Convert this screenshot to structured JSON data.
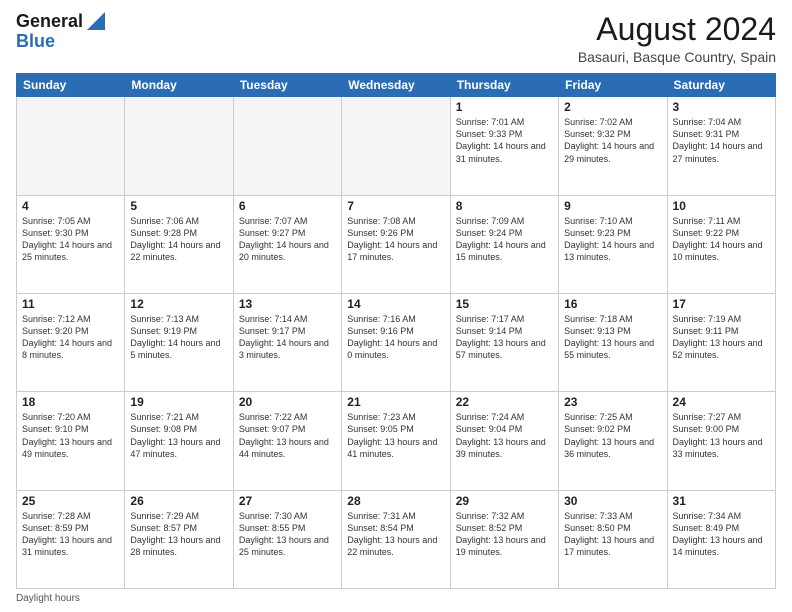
{
  "header": {
    "logo_general": "General",
    "logo_blue": "Blue",
    "main_title": "August 2024",
    "subtitle": "Basauri, Basque Country, Spain"
  },
  "days_of_week": [
    "Sunday",
    "Monday",
    "Tuesday",
    "Wednesday",
    "Thursday",
    "Friday",
    "Saturday"
  ],
  "weeks": [
    [
      {
        "date": "",
        "content": ""
      },
      {
        "date": "",
        "content": ""
      },
      {
        "date": "",
        "content": ""
      },
      {
        "date": "",
        "content": ""
      },
      {
        "date": "1",
        "content": "Sunrise: 7:01 AM\nSunset: 9:33 PM\nDaylight: 14 hours and 31 minutes."
      },
      {
        "date": "2",
        "content": "Sunrise: 7:02 AM\nSunset: 9:32 PM\nDaylight: 14 hours and 29 minutes."
      },
      {
        "date": "3",
        "content": "Sunrise: 7:04 AM\nSunset: 9:31 PM\nDaylight: 14 hours and 27 minutes."
      }
    ],
    [
      {
        "date": "4",
        "content": "Sunrise: 7:05 AM\nSunset: 9:30 PM\nDaylight: 14 hours and 25 minutes."
      },
      {
        "date": "5",
        "content": "Sunrise: 7:06 AM\nSunset: 9:28 PM\nDaylight: 14 hours and 22 minutes."
      },
      {
        "date": "6",
        "content": "Sunrise: 7:07 AM\nSunset: 9:27 PM\nDaylight: 14 hours and 20 minutes."
      },
      {
        "date": "7",
        "content": "Sunrise: 7:08 AM\nSunset: 9:26 PM\nDaylight: 14 hours and 17 minutes."
      },
      {
        "date": "8",
        "content": "Sunrise: 7:09 AM\nSunset: 9:24 PM\nDaylight: 14 hours and 15 minutes."
      },
      {
        "date": "9",
        "content": "Sunrise: 7:10 AM\nSunset: 9:23 PM\nDaylight: 14 hours and 13 minutes."
      },
      {
        "date": "10",
        "content": "Sunrise: 7:11 AM\nSunset: 9:22 PM\nDaylight: 14 hours and 10 minutes."
      }
    ],
    [
      {
        "date": "11",
        "content": "Sunrise: 7:12 AM\nSunset: 9:20 PM\nDaylight: 14 hours and 8 minutes."
      },
      {
        "date": "12",
        "content": "Sunrise: 7:13 AM\nSunset: 9:19 PM\nDaylight: 14 hours and 5 minutes."
      },
      {
        "date": "13",
        "content": "Sunrise: 7:14 AM\nSunset: 9:17 PM\nDaylight: 14 hours and 3 minutes."
      },
      {
        "date": "14",
        "content": "Sunrise: 7:16 AM\nSunset: 9:16 PM\nDaylight: 14 hours and 0 minutes."
      },
      {
        "date": "15",
        "content": "Sunrise: 7:17 AM\nSunset: 9:14 PM\nDaylight: 13 hours and 57 minutes."
      },
      {
        "date": "16",
        "content": "Sunrise: 7:18 AM\nSunset: 9:13 PM\nDaylight: 13 hours and 55 minutes."
      },
      {
        "date": "17",
        "content": "Sunrise: 7:19 AM\nSunset: 9:11 PM\nDaylight: 13 hours and 52 minutes."
      }
    ],
    [
      {
        "date": "18",
        "content": "Sunrise: 7:20 AM\nSunset: 9:10 PM\nDaylight: 13 hours and 49 minutes."
      },
      {
        "date": "19",
        "content": "Sunrise: 7:21 AM\nSunset: 9:08 PM\nDaylight: 13 hours and 47 minutes."
      },
      {
        "date": "20",
        "content": "Sunrise: 7:22 AM\nSunset: 9:07 PM\nDaylight: 13 hours and 44 minutes."
      },
      {
        "date": "21",
        "content": "Sunrise: 7:23 AM\nSunset: 9:05 PM\nDaylight: 13 hours and 41 minutes."
      },
      {
        "date": "22",
        "content": "Sunrise: 7:24 AM\nSunset: 9:04 PM\nDaylight: 13 hours and 39 minutes."
      },
      {
        "date": "23",
        "content": "Sunrise: 7:25 AM\nSunset: 9:02 PM\nDaylight: 13 hours and 36 minutes."
      },
      {
        "date": "24",
        "content": "Sunrise: 7:27 AM\nSunset: 9:00 PM\nDaylight: 13 hours and 33 minutes."
      }
    ],
    [
      {
        "date": "25",
        "content": "Sunrise: 7:28 AM\nSunset: 8:59 PM\nDaylight: 13 hours and 31 minutes."
      },
      {
        "date": "26",
        "content": "Sunrise: 7:29 AM\nSunset: 8:57 PM\nDaylight: 13 hours and 28 minutes."
      },
      {
        "date": "27",
        "content": "Sunrise: 7:30 AM\nSunset: 8:55 PM\nDaylight: 13 hours and 25 minutes."
      },
      {
        "date": "28",
        "content": "Sunrise: 7:31 AM\nSunset: 8:54 PM\nDaylight: 13 hours and 22 minutes."
      },
      {
        "date": "29",
        "content": "Sunrise: 7:32 AM\nSunset: 8:52 PM\nDaylight: 13 hours and 19 minutes."
      },
      {
        "date": "30",
        "content": "Sunrise: 7:33 AM\nSunset: 8:50 PM\nDaylight: 13 hours and 17 minutes."
      },
      {
        "date": "31",
        "content": "Sunrise: 7:34 AM\nSunset: 8:49 PM\nDaylight: 13 hours and 14 minutes."
      }
    ]
  ],
  "footer": {
    "daylight_label": "Daylight hours"
  },
  "colors": {
    "header_bg": "#2a6db5",
    "accent": "#2a6db5"
  }
}
